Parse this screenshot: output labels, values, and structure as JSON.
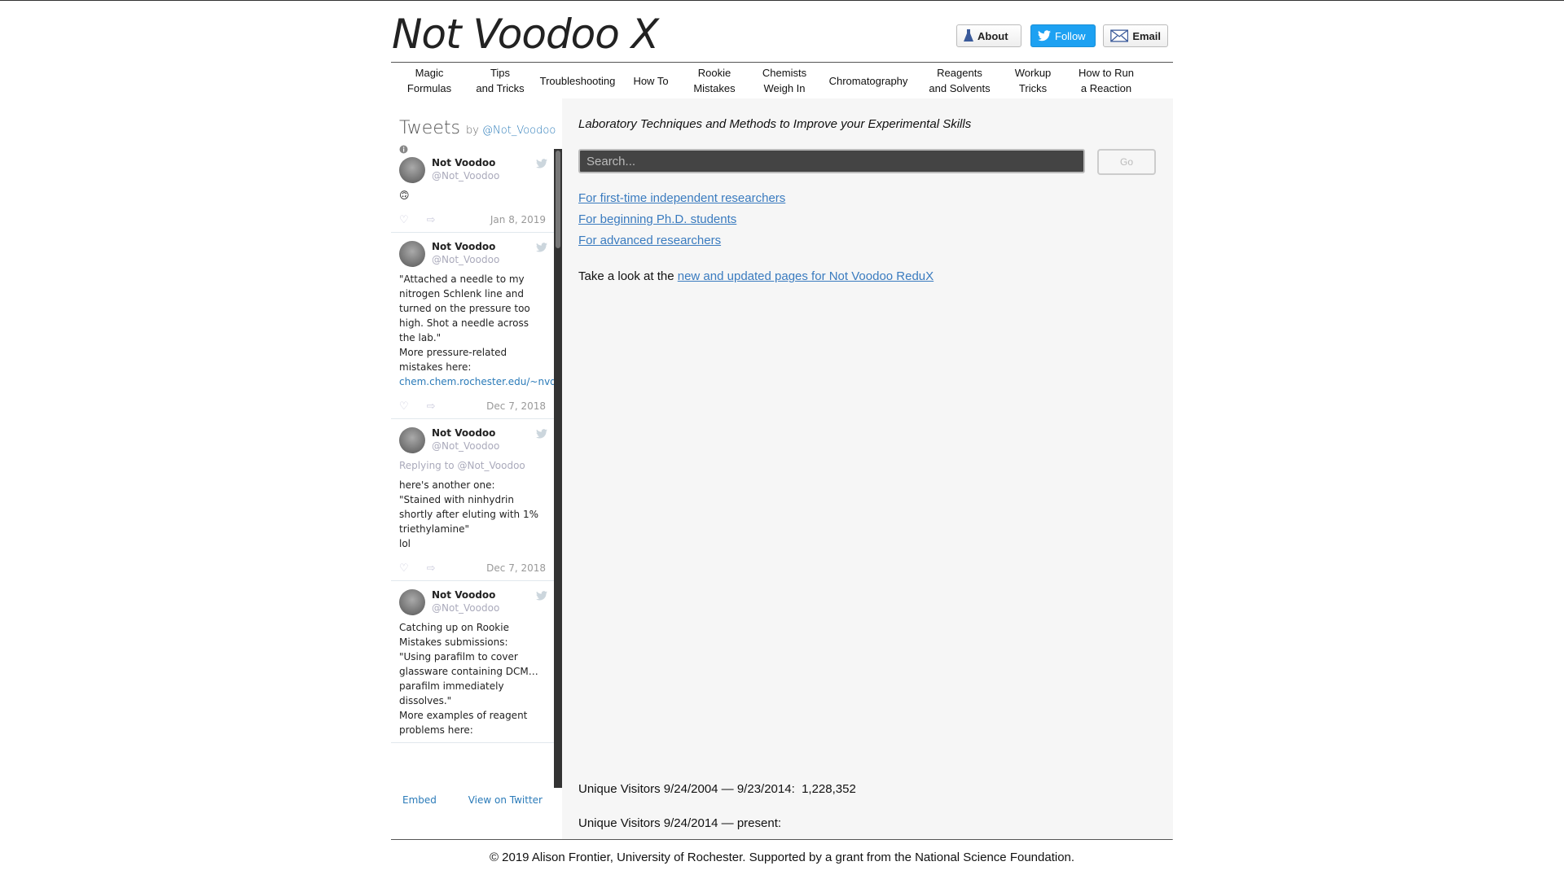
{
  "site": {
    "logo": "Not Voodoo X",
    "header_buttons": {
      "about": "About",
      "follow": "Follow",
      "email": "Email"
    }
  },
  "nav": [
    {
      "label": "Magic\nFormulas"
    },
    {
      "label": "Tips\nand Tricks"
    },
    {
      "label": "Troubleshooting"
    },
    {
      "label": "How To"
    },
    {
      "label": "Rookie\nMistakes"
    },
    {
      "label": "Chemists\nWeigh In"
    },
    {
      "label": "Chromatography"
    },
    {
      "label": "Reagents\nand Solvents"
    },
    {
      "label": "Workup\nTricks"
    },
    {
      "label": "How to Run\na Reaction"
    }
  ],
  "tweets_widget": {
    "title": "Tweets",
    "by": "by",
    "handle_link": "@Not_Voodoo",
    "items": [
      {
        "name": "Not Voodoo",
        "handle": "@Not_Voodoo",
        "reply_to": "",
        "text": "🙃",
        "link": "",
        "date": "Jan 8, 2019"
      },
      {
        "name": "Not Voodoo",
        "handle": "@Not_Voodoo",
        "reply_to": "",
        "text": "\"Attached a needle to my nitrogen Schlenk line and turned on the pressure too high. Shot a needle across the lab.\"\nMore pressure-related mistakes here:",
        "link": "chem.chem.rochester.edu/~nvd/pages/roo…",
        "date": "Dec 7, 2018"
      },
      {
        "name": "Not Voodoo",
        "handle": "@Not_Voodoo",
        "reply_to": "Replying to @Not_Voodoo",
        "text": "here's another one:\n\"Stained with ninhydrin shortly after eluting with 1% triethylamine\"\nlol",
        "link": "",
        "date": "Dec 7, 2018"
      },
      {
        "name": "Not Voodoo",
        "handle": "@Not_Voodoo",
        "reply_to": "",
        "text": "Catching up on Rookie Mistakes submissions:\n\"Using parafilm to cover glassware containing DCM… parafilm immediately dissolves.\"\nMore examples of reagent problems here:",
        "link": "",
        "date": ""
      }
    ],
    "footer": {
      "embed": "Embed",
      "view": "View on Twitter"
    }
  },
  "main": {
    "tagline": "Laboratory Techniques and Methods to Improve your Experimental Skills",
    "search": {
      "placeholder": "Search...",
      "go": "Go"
    },
    "audience_links": [
      "For first-time independent researchers",
      "For beginning Ph.D. students",
      "For advanced researchers"
    ],
    "redux_prefix": "Take a look at the ",
    "redux_link": "new and updated pages for Not Voodoo ReduX",
    "visitors_1": "Unique Visitors 9/24/2004 — 9/23/2014:  1,228,352",
    "visitors_2": "Unique Visitors 9/24/2014 — present:"
  },
  "footer": {
    "copyright": "© 2019 Alison Frontier, University of Rochester. Supported by a grant from the National Science Foundation."
  }
}
